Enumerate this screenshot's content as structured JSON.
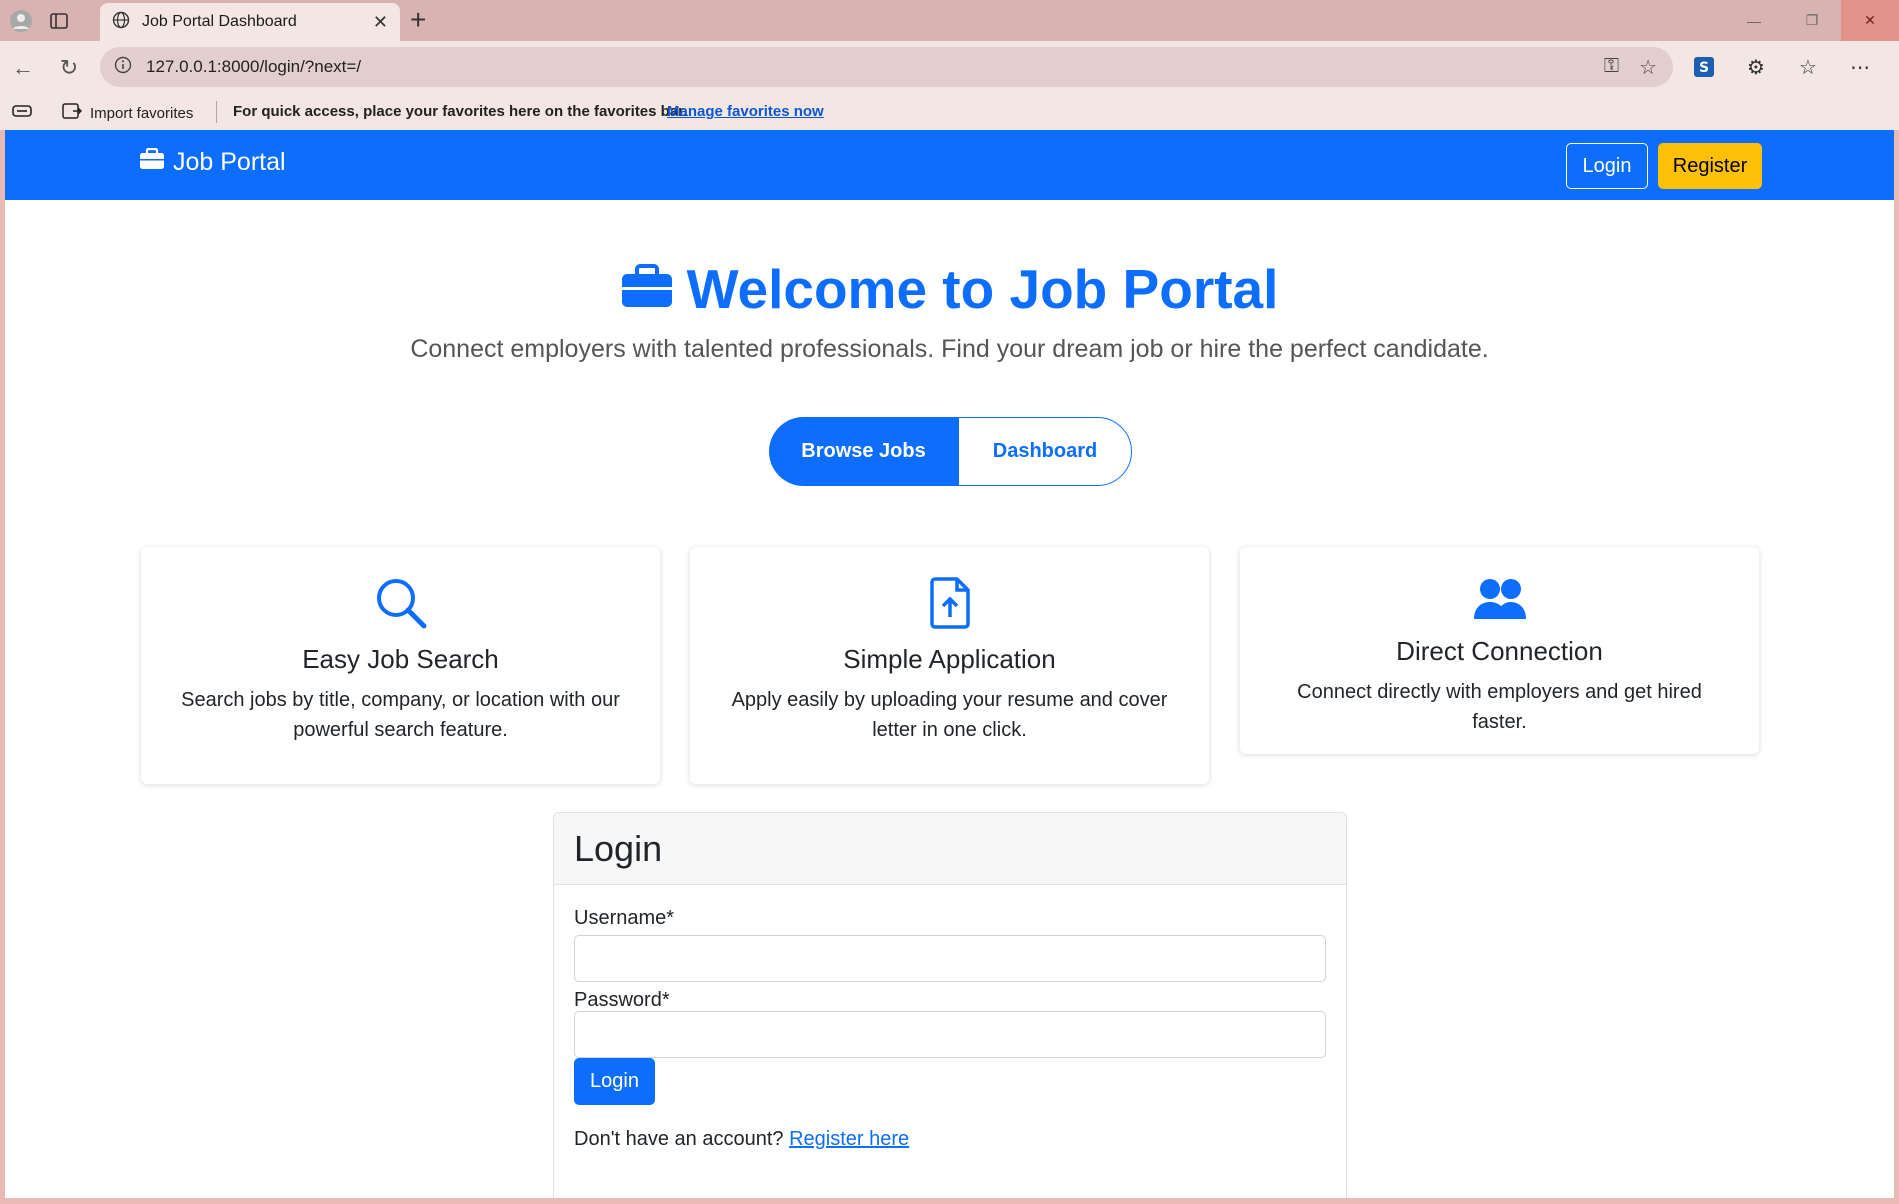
{
  "browser": {
    "tab_title": "Job Portal Dashboard",
    "url": "127.0.0.1:8000/login/?next=/",
    "fav_import": "Import favorites",
    "fav_message": "For quick access, place your favorites here on the favorites bar.",
    "fav_link": "Manage favorites now"
  },
  "navbar": {
    "brand": "Job Portal",
    "login": "Login",
    "register": "Register"
  },
  "hero": {
    "title": "Welcome to Job Portal",
    "subtitle": "Connect employers with talented professionals. Find your dream job or hire the perfect candidate.",
    "browse_label": "Browse Jobs",
    "dashboard_label": "Dashboard"
  },
  "features": [
    {
      "title": "Easy Job Search",
      "text": "Search jobs by title, company, or location with our powerful search feature.",
      "icon": "search-icon"
    },
    {
      "title": "Simple Application",
      "text": "Apply easily by uploading your resume and cover letter in one click.",
      "icon": "file-upload-icon"
    },
    {
      "title": "Direct Connection",
      "text": "Connect directly with employers and get hired faster.",
      "icon": "people-icon"
    }
  ],
  "login": {
    "header": "Login",
    "username_label": "Username*",
    "username_value": "",
    "password_label": "Password*",
    "password_value": "",
    "submit_label": "Login",
    "no_account_text": "Don't have an account?",
    "register_link": "Register here"
  },
  "colors": {
    "primary": "#0d6efd",
    "warning": "#ffc107",
    "browser_frame": "#d9b3b1"
  }
}
